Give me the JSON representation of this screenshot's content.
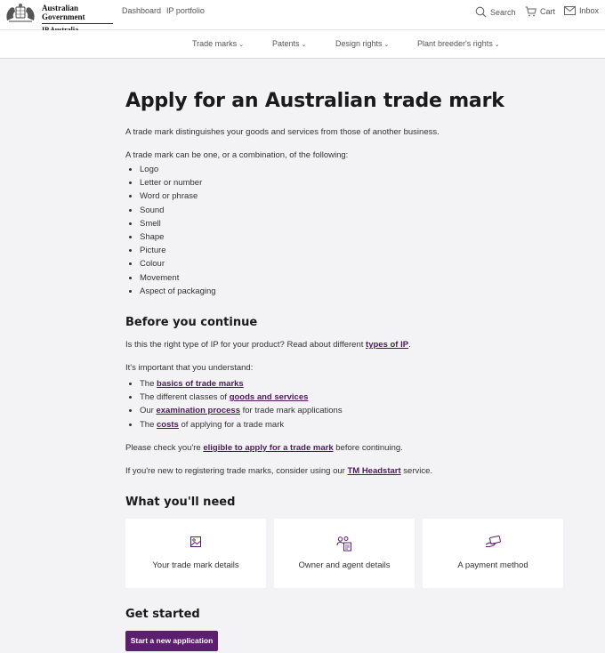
{
  "header": {
    "brand_top": "Australian Government",
    "brand_bottom": "IP Australia",
    "links": [
      "Dashboard",
      "IP portfolio"
    ],
    "search": "Search",
    "cart": "Cart",
    "inbox": "Inbox"
  },
  "nav": {
    "items": [
      "Trade marks",
      "Patents",
      "Design rights",
      "Plant breeder's rights"
    ]
  },
  "main": {
    "title": "Apply for an Australian trade mark",
    "intro": "A trade mark distinguishes your goods and services from those of another business.",
    "list_intro": "A trade mark can be one, or a combination, of the following:",
    "types": [
      "Logo",
      "Letter or number",
      "Word or phrase",
      "Sound",
      "Smell",
      "Shape",
      "Picture",
      "Colour",
      "Movement",
      "Aspect of packaging"
    ],
    "before_heading": "Before you continue",
    "right_type_pre": "Is this the right type of IP for your product? Read about different ",
    "right_type_link": "types of IP",
    "right_type_post": ".",
    "understand": "It's important that you understand:",
    "understand_items": [
      {
        "pre": "The ",
        "link": "basics of trade marks",
        "post": ""
      },
      {
        "pre": "The different classes of ",
        "link": "goods and services",
        "post": ""
      },
      {
        "pre": "Our ",
        "link": "examination process",
        "post": " for trade mark applications"
      },
      {
        "pre": "The ",
        "link": "costs",
        "post": " of applying for a trade mark"
      }
    ],
    "eligible_pre": "Please check you're ",
    "eligible_link": "eligible to apply for a trade mark",
    "eligible_post": " before continuing.",
    "headstart_pre": "If you're new to registering trade marks, consider using our ",
    "headstart_link": "TM Headstart",
    "headstart_post": " service.",
    "need_heading": "What you'll need",
    "cards": [
      "Your trade mark details",
      "Owner and agent details",
      "A payment method"
    ],
    "started_heading": "Get started",
    "start_button": "Start a new application"
  },
  "colors": {
    "accent": "#5c1e6e",
    "link": "#4d1a5c",
    "page_bg": "#f3f3f5"
  }
}
